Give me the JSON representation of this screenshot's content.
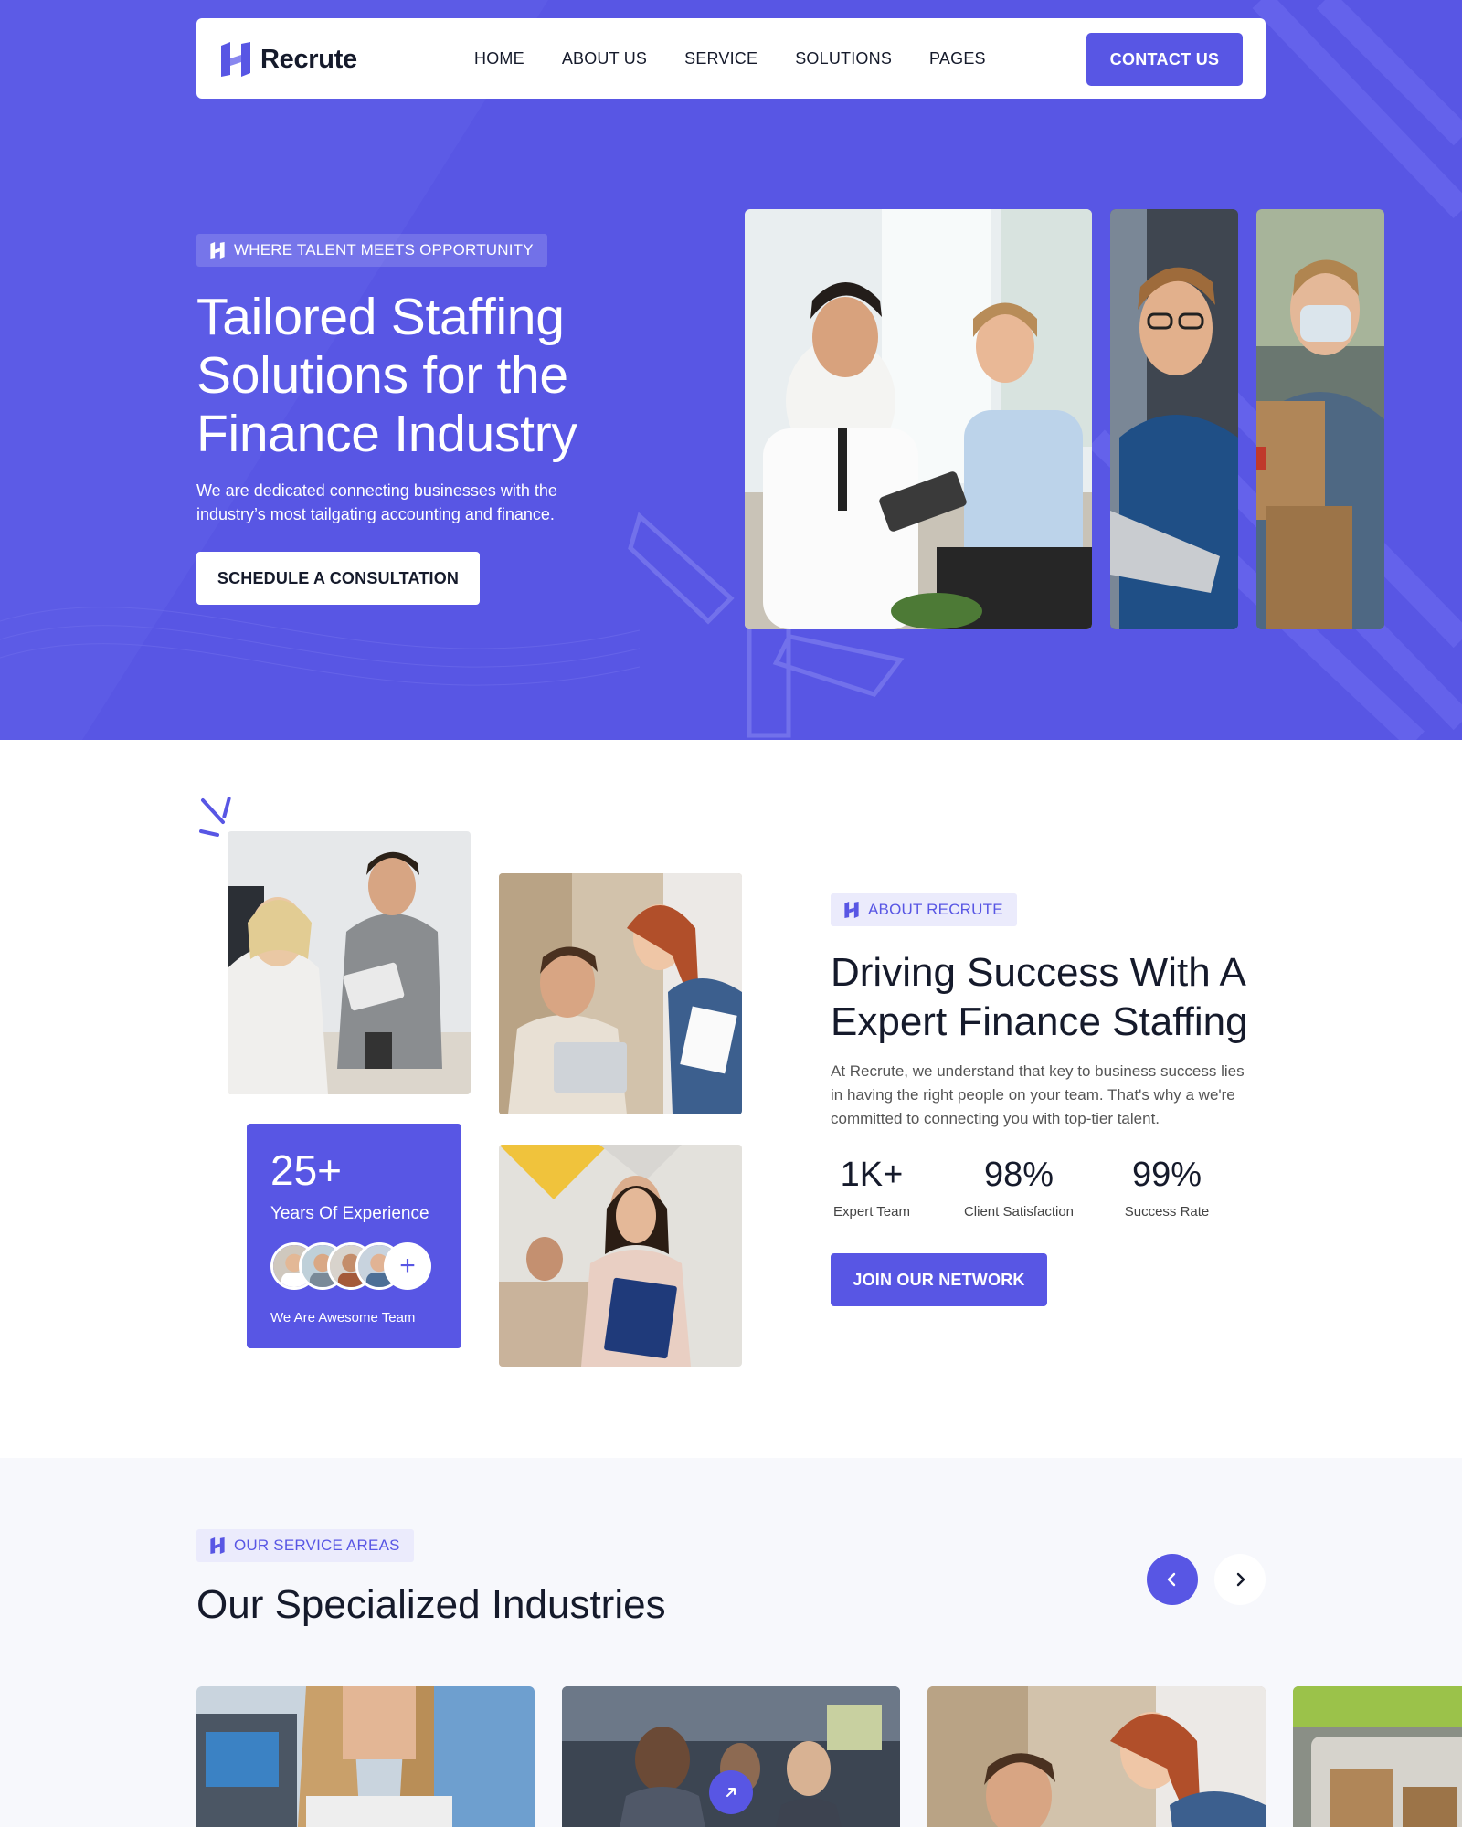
{
  "brand": {
    "name": "Recrute",
    "accent": "#5856e4"
  },
  "nav": {
    "items": [
      "HOME",
      "ABOUT US",
      "SERVICE",
      "SOLUTIONS",
      "PAGES"
    ],
    "cta": "CONTACT US"
  },
  "hero": {
    "tag": "WHERE TALENT MEETS OPPORTUNITY",
    "title_lines": [
      "Tailored Staffing",
      "Solutions for the",
      "Finance Industry"
    ],
    "description": "We are dedicated connecting businesses with the industry’s most tailgating accounting and finance.",
    "button": "SCHEDULE A CONSULTATION"
  },
  "about": {
    "tag": "ABOUT RECRUTE",
    "title_lines": [
      "Driving Success With A",
      "Expert Finance Staffing"
    ],
    "description": "At Recrute, we understand that key to business success lies in having the right people on your team. That's why a we're committed to connecting you with top-tier talent.",
    "experience": {
      "value": "25+",
      "label": "Years Of Experience",
      "team_label": "We Are Awesome Team"
    },
    "stats": [
      {
        "value": "1K+",
        "label": "Expert Team"
      },
      {
        "value": "98%",
        "label": "Client Satisfaction"
      },
      {
        "value": "99%",
        "label": "Success Rate"
      }
    ],
    "button": "JOIN OUR NETWORK"
  },
  "services": {
    "tag": "OUR SERVICE AREAS",
    "title": "Our Specialized Industries"
  },
  "icons": [
    "logo-icon",
    "tag-logo-icon",
    "plus-icon",
    "chevron-left-icon",
    "chevron-right-icon",
    "arrow-up-right-icon"
  ]
}
